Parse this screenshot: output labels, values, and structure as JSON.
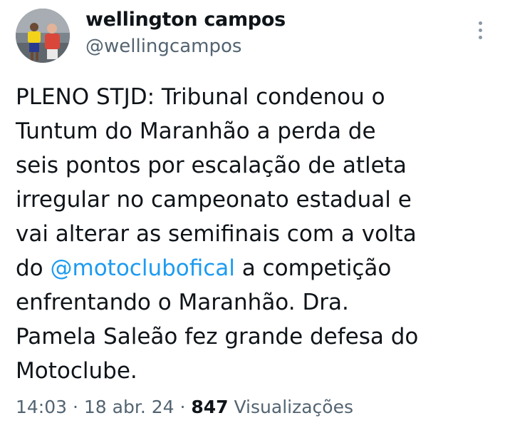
{
  "author": {
    "name": "wellington campos",
    "handle": "@wellingcampos"
  },
  "tweet": {
    "line1": "PLENO STJD: Tribunal condenou o",
    "line2": "Tuntum do Maranhão a perda de",
    "line3": "seis pontos por escalação de atleta",
    "line4": "irregular no campeonato estadual e",
    "line5": "vai alterar as semifinais com a volta",
    "line6_pre": "do ",
    "mention": "@motoclubofical",
    "line6_post": " a competição",
    "line7": "enfrentando o Maranhão. Dra.",
    "line8": "Pamela Saleão fez grande defesa do",
    "line9": "Motoclube."
  },
  "meta": {
    "time": "14:03",
    "sep1": " · ",
    "date": "18 abr. 24",
    "sep2": " · ",
    "views_count": "847",
    "views_label": " Visualizações"
  },
  "icons": {
    "more": "more-vertical-icon"
  },
  "colors": {
    "link": "#1d9bf0",
    "secondary": "#536471",
    "text": "#0f1419"
  }
}
